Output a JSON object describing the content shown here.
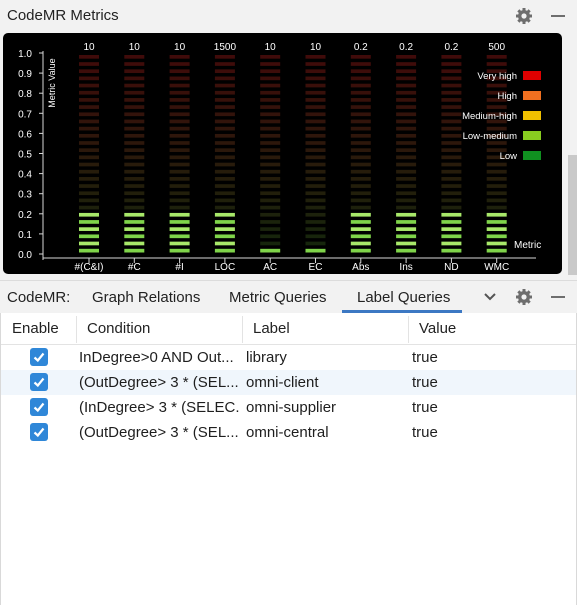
{
  "panel": {
    "title": "CodeMR Metrics",
    "gear_label": "Settings",
    "minimize_label": "Minimize"
  },
  "chart_data": {
    "type": "bar",
    "style": "segmented LED meter",
    "ylabel": "Metric Value",
    "xlabel": "Metric",
    "ylim": [
      0,
      1.0
    ],
    "yticks": [
      "0.0",
      "0.1",
      "0.2",
      "0.3",
      "0.4",
      "0.5",
      "0.6",
      "0.7",
      "0.8",
      "0.9",
      "1.0"
    ],
    "categories": [
      "#(C&I)",
      "#C",
      "#I",
      "LOC",
      "AC",
      "EC",
      "Abs",
      "Ins",
      "ND",
      "WMC"
    ],
    "max_labels": [
      "10",
      "10",
      "10",
      "1500",
      "10",
      "10",
      "0.2",
      "0.2",
      "0.2",
      "500"
    ],
    "values": [
      0.2,
      0.2,
      0.2,
      0.2,
      0.05,
      0.05,
      0.2,
      0.2,
      0.2,
      0.23
    ],
    "legend_position": "top-right",
    "legend": [
      {
        "label": "Very high",
        "color": "#e00000"
      },
      {
        "label": "High",
        "color": "#f07020"
      },
      {
        "label": "Medium-high",
        "color": "#f0c000"
      },
      {
        "label": "Low-medium",
        "color": "#88cc20"
      },
      {
        "label": "Low",
        "color": "#109020"
      }
    ],
    "grid": false
  },
  "tabs": {
    "prefix": "CodeMR:",
    "items": [
      {
        "label": "Graph Relations"
      },
      {
        "label": "Metric Queries"
      },
      {
        "label": "Label Queries"
      }
    ],
    "active": "Label Queries"
  },
  "table": {
    "headers": [
      "Enable",
      "Condition",
      "Label",
      "Value"
    ],
    "rows": [
      {
        "enabled": true,
        "condition": "InDegree>0 AND Out...",
        "label": "library",
        "value": "true"
      },
      {
        "enabled": true,
        "condition": " (OutDegree> 3 * (SEL...",
        "label": "omni-client",
        "value": "true"
      },
      {
        "enabled": true,
        "condition": "(InDegree> 3 * (SELEC...",
        "label": "omni-supplier",
        "value": "true"
      },
      {
        "enabled": true,
        "condition": " (OutDegree> 3 * (SEL...",
        "label": "omni-central",
        "value": "true"
      }
    ]
  },
  "colors": {
    "accent": "#3c78c3",
    "checkbox": "#2f87d8",
    "led_off_top": "#3a0b0b",
    "led_on": "#9be05a"
  }
}
